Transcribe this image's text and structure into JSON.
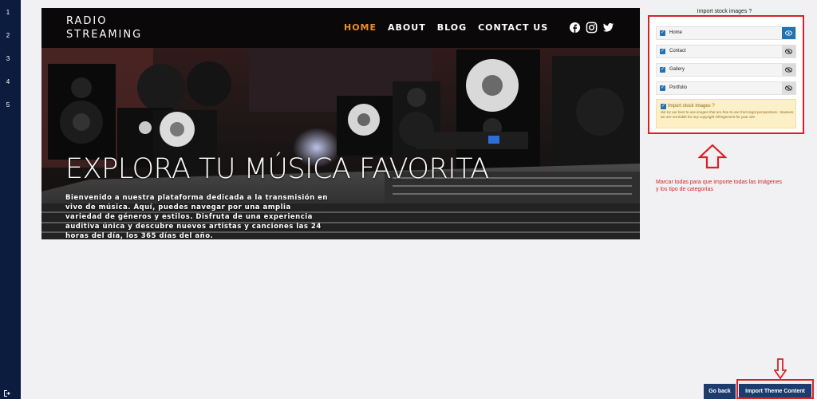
{
  "steps": [
    "1",
    "2",
    "3",
    "4",
    "5"
  ],
  "site": {
    "logo_line1": "RADIO",
    "logo_line2": "STREAMING",
    "nav": [
      {
        "label": "HOME",
        "active": true
      },
      {
        "label": "ABOUT",
        "active": false
      },
      {
        "label": "BLOG",
        "active": false
      },
      {
        "label": "CONTACT US",
        "active": false
      }
    ],
    "social_icons": [
      "facebook-icon",
      "instagram-icon",
      "twitter-icon"
    ],
    "hero_title": "EXPLORA TU MÚSICA FAVORITA",
    "hero_text": "Bienvenido a nuestra plataforma dedicada a la transmisión en vivo de música. Aquí, puedes navegar por una amplia variedad de géneros y estilos. Disfruta de una experiencia auditiva única y descubre nuevos artistas y canciones las 24 horas del día, los 365 días del año."
  },
  "import_panel": {
    "title": "Import stock images ?",
    "items": [
      {
        "label": "Home",
        "checked": true,
        "preview_active": true
      },
      {
        "label": "Contact",
        "checked": true,
        "preview_active": false
      },
      {
        "label": "Gallery",
        "checked": true,
        "preview_active": false
      },
      {
        "label": "Portfolio",
        "checked": true,
        "preview_active": false
      }
    ],
    "notice_title": "Import stock images ?",
    "notice_text": "We try our best to use images that are free to use from legal perspectives. However, we are not liable for any copyright infringement for your site."
  },
  "instruction": "Marcar todas para que importe todas las imágenes y los tipo de categorías",
  "buttons": {
    "go_back": "Go back",
    "import": "Import Theme Content"
  },
  "colors": {
    "sidebar": "#0c1c3e",
    "accent_nav": "#ef8d2a",
    "highlight_red": "#d92129",
    "button_blue": "#1d3b6c",
    "checkbox_blue": "#2271b1"
  }
}
